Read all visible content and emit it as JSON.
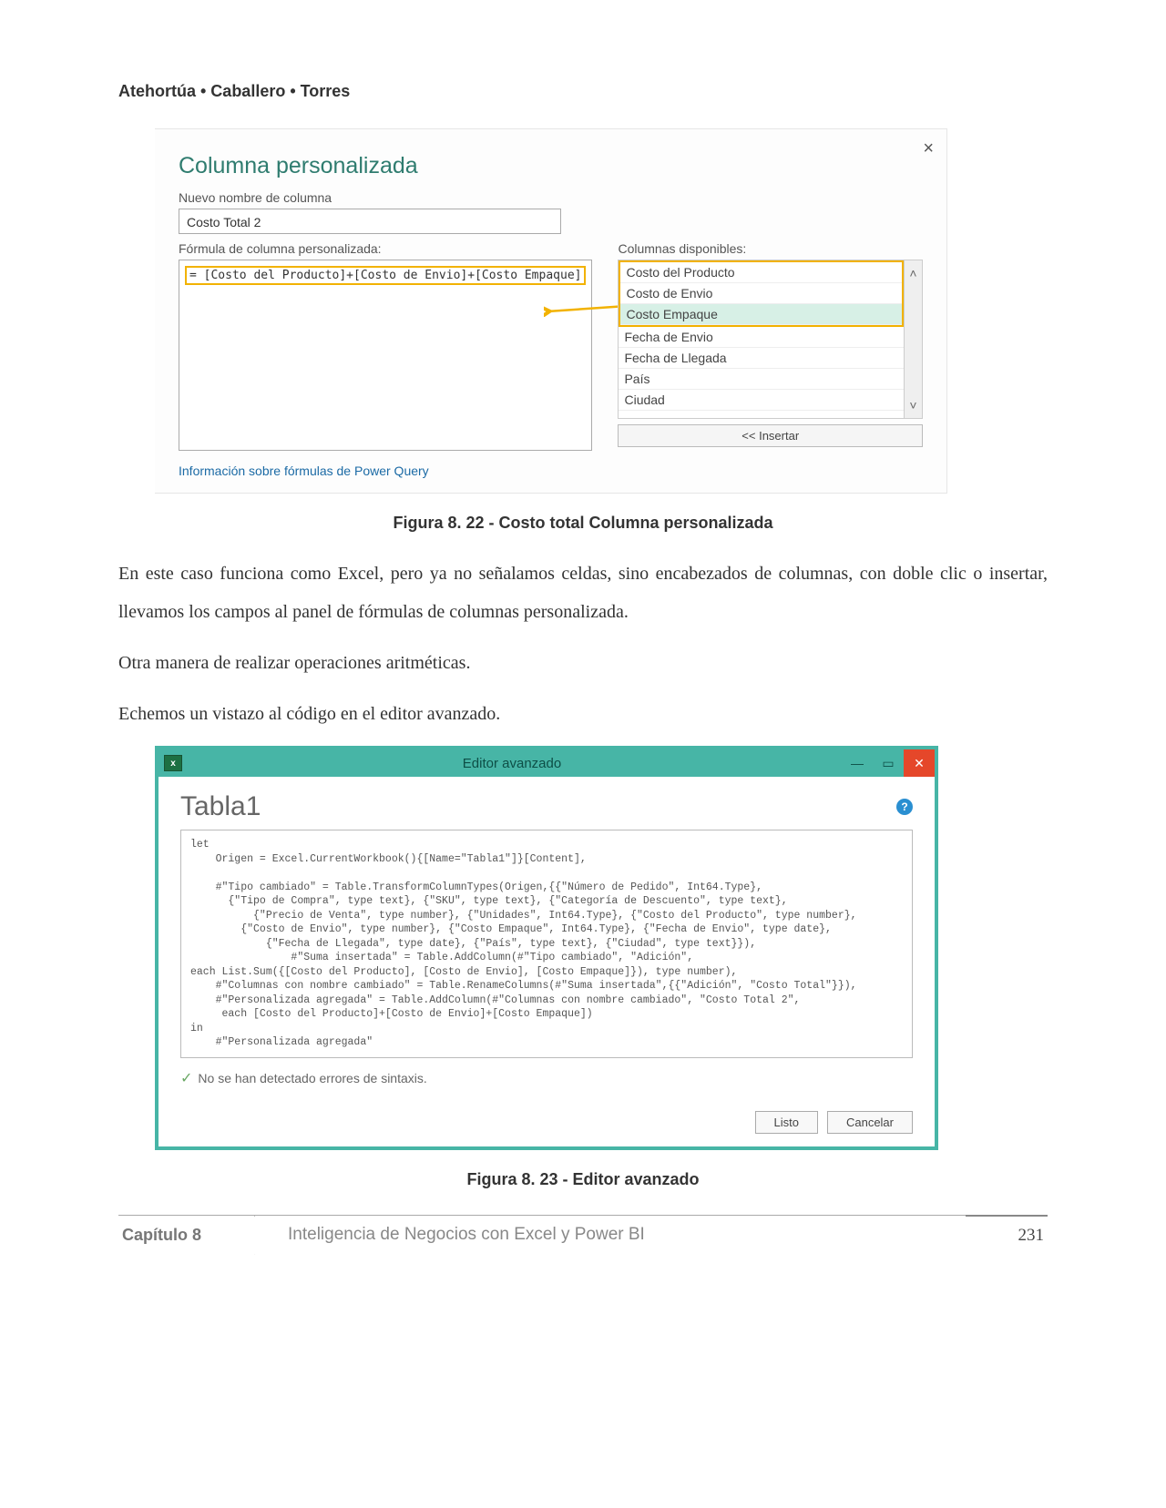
{
  "authors": "Atehortúa • Caballero • Torres",
  "dialog1": {
    "title": "Columna personalizada",
    "new_col_label": "Nuevo nombre de columna",
    "new_col_value": "Costo Total 2",
    "formula_label": "Fórmula de columna personalizada:",
    "formula_value": "= [Costo del Producto]+[Costo de Envio]+[Costo Empaque]",
    "avail_label": "Columnas disponibles:",
    "avail_items": [
      "Costo del Producto",
      "Costo de Envio",
      "Costo Empaque",
      "Fecha de Envio",
      "Fecha de Llegada",
      "País",
      "Ciudad"
    ],
    "insert_btn": "<< Insertar",
    "pq_link": "Información sobre fórmulas de Power Query"
  },
  "fig1_caption": "Figura 8. 22 - Costo total Columna personalizada",
  "para1": "En este caso funciona como Excel,  pero ya no señalamos celdas, sino encabezados de columnas, con doble clic o insertar, llevamos los campos al panel de fórmulas de columnas personalizada.",
  "para2": "Otra manera de realizar operaciones aritméticas.",
  "para3": "Echemos un vistazo al código en el editor avanzado.",
  "dialog2": {
    "window_title": "Editor avanzado",
    "table_name": "Tabla1",
    "code": "let\n    Origen = Excel.CurrentWorkbook(){[Name=\"Tabla1\"]}[Content],\n\n    #\"Tipo cambiado\" = Table.TransformColumnTypes(Origen,{{\"Número de Pedido\", Int64.Type},\n      {\"Tipo de Compra\", type text}, {\"SKU\", type text}, {\"Categoría de Descuento\", type text},\n          {\"Precio de Venta\", type number}, {\"Unidades\", Int64.Type}, {\"Costo del Producto\", type number},\n        {\"Costo de Envio\", type number}, {\"Costo Empaque\", Int64.Type}, {\"Fecha de Envio\", type date},\n            {\"Fecha de Llegada\", type date}, {\"País\", type text}, {\"Ciudad\", type text}}),\n                #\"Suma insertada\" = Table.AddColumn(#\"Tipo cambiado\", \"Adición\",\neach List.Sum({[Costo del Producto], [Costo de Envio], [Costo Empaque]}), type number),\n    #\"Columnas con nombre cambiado\" = Table.RenameColumns(#\"Suma insertada\",{{\"Adición\", \"Costo Total\"}}),\n    #\"Personalizada agregada\" = Table.AddColumn(#\"Columnas con nombre cambiado\", \"Costo Total 2\",\n     each [Costo del Producto]+[Costo de Envio]+[Costo Empaque])\nin\n    #\"Personalizada agregada\"",
    "syntax_ok": "No se han detectado errores de sintaxis.",
    "btn_done": "Listo",
    "btn_cancel": "Cancelar"
  },
  "fig2_caption": "Figura 8. 23 - Editor avanzado",
  "footer": {
    "chapter": "Capítulo 8",
    "title": "Inteligencia de Negocios con Excel y Power BI",
    "page": "231"
  }
}
